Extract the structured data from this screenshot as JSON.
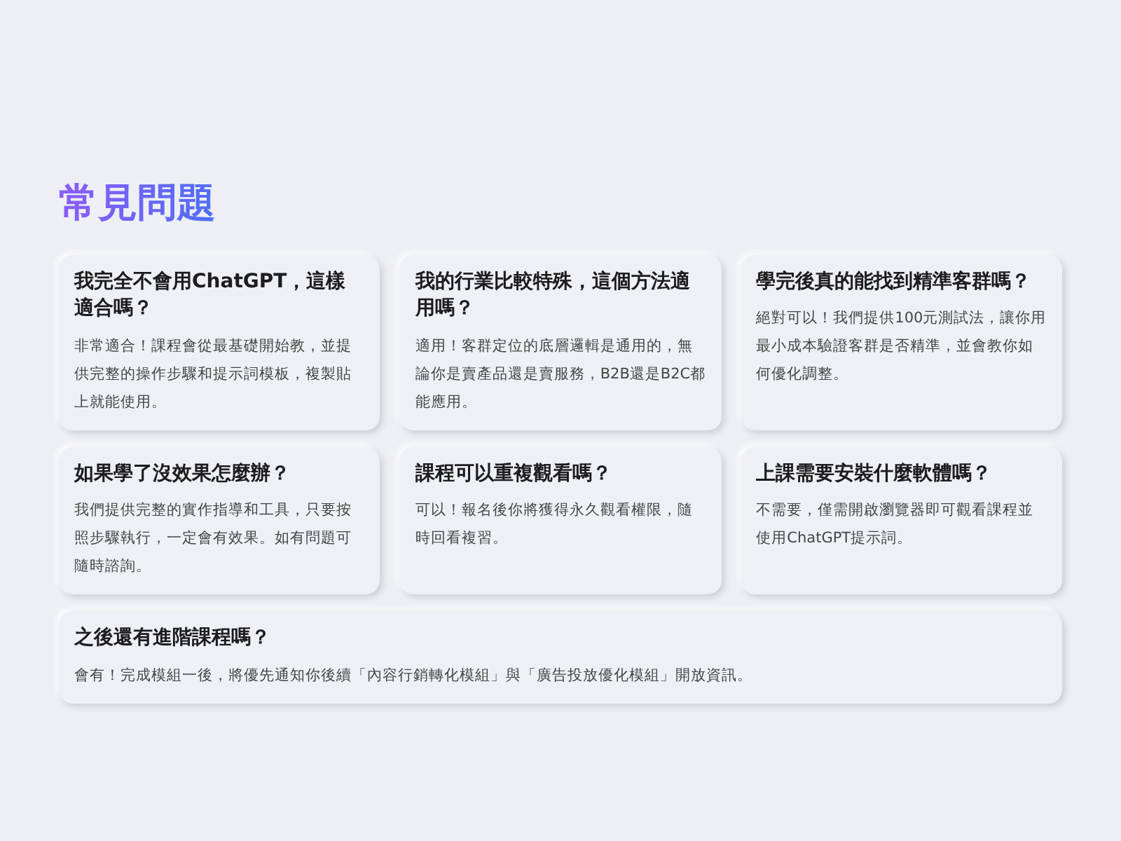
{
  "title": "常見問題",
  "faqs": [
    {
      "kind": "card",
      "question": "我完全不會用ChatGPT，這樣適合嗎？",
      "answer": "非常適合！課程會從最基礎開始教，並提供完整的操作步驟和提示詞模板，複製貼上就能使用。"
    },
    {
      "kind": "card",
      "question": "我的行業比較特殊，這個方法適用嗎？",
      "answer": "適用！客群定位的底層邏輯是通用的，無論你是賣產品還是賣服務，B2B還是B2C都能應用。"
    },
    {
      "kind": "card",
      "question": "學完後真的能找到精準客群嗎？",
      "answer": "絕對可以！我們提供100元測試法，讓你用最小成本驗證客群是否精準，並會教你如何優化調整。"
    },
    {
      "kind": "card",
      "question": "如果學了沒效果怎麼辦？",
      "answer": "我們提供完整的實作指導和工具，只要按照步驟執行，一定會有效果。如有問題可隨時諮詢。"
    },
    {
      "kind": "card",
      "question": "課程可以重複觀看嗎？",
      "answer": "可以！報名後你將獲得永久觀看權限，隨時回看複習。"
    },
    {
      "kind": "card",
      "question": "上課需要安裝什麼軟體嗎？",
      "answer": "不需要，僅需開啟瀏覽器即可觀看課程並使用ChatGPT提示詞。"
    },
    {
      "kind": "wide",
      "question": "之後還有進階課程嗎？",
      "answer": "會有！完成模組一後，將優先通知你後續「內容行銷轉化模組」與「廣告投放優化模組」開放資訊。"
    }
  ]
}
